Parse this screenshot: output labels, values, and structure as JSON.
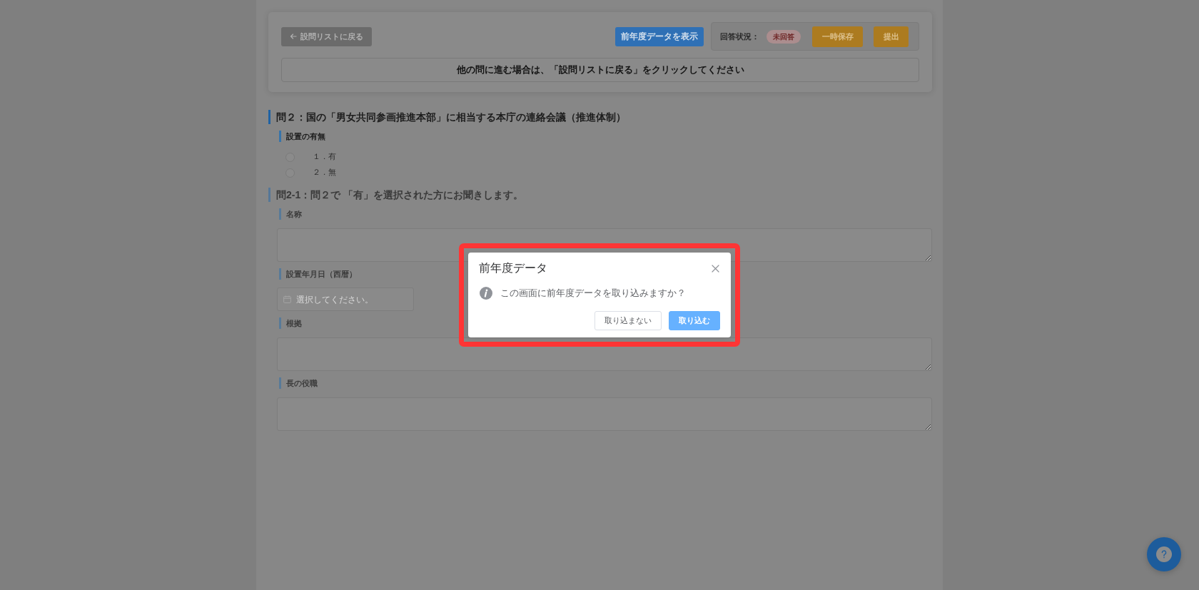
{
  "header": {
    "back_button": "設問リストに戻る",
    "prev_data_button": "前年度データを表示",
    "status_label": "回答状況：",
    "status_badge": "未回答",
    "actions": [
      "一時保存",
      "提出"
    ],
    "notice": "他の問に進む場合は、「設問リストに戻る」をクリックしてください"
  },
  "sections": [
    {
      "title": "問２：国の「男女共同参画推進本部」に相当する本庁の連絡会議（推進体制）",
      "disabled": false,
      "fields": [
        {
          "kind": "radio",
          "label": "設置の有無",
          "options": [
            {
              "label": "１．有",
              "selected": false
            },
            {
              "label": "２．無",
              "selected": false
            }
          ]
        }
      ]
    },
    {
      "title": "問2-1：問２で 「有」を選択された方にお聞きします。",
      "disabled": true,
      "fields": [
        {
          "kind": "textarea",
          "label": "名称"
        },
        {
          "kind": "date",
          "label": "設置年月日（西暦）",
          "placeholder": "選択してください。"
        },
        {
          "kind": "textarea",
          "label": "根拠"
        },
        {
          "kind": "textarea",
          "label": "長の役職"
        }
      ]
    }
  ],
  "dialog": {
    "title": "前年度データ",
    "message": "この画面に前年度データを取り込みますか？",
    "buttons": [
      {
        "label": "取り込まない",
        "kind": "default"
      },
      {
        "label": "取り込む",
        "kind": "primary"
      }
    ]
  }
}
